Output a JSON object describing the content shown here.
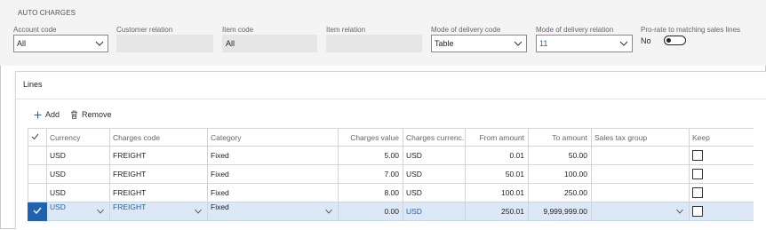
{
  "section_title": "AUTO CHARGES",
  "fields": {
    "account_code": {
      "label": "Account code",
      "value": "All"
    },
    "customer_relation": {
      "label": "Customer relation",
      "value": ""
    },
    "item_code": {
      "label": "Item code",
      "value": "All"
    },
    "item_relation": {
      "label": "Item relation",
      "value": ""
    },
    "mode_of_delivery_code": {
      "label": "Mode of delivery code",
      "value": "Table"
    },
    "mode_of_delivery_relation": {
      "label": "Mode of delivery relation",
      "value": "11"
    },
    "prorate": {
      "label": "Pro-rate to matching sales lines",
      "value": "No"
    }
  },
  "lines": {
    "title": "Lines",
    "add_label": "Add",
    "remove_label": "Remove",
    "columns": [
      "Currency",
      "Charges code",
      "Category",
      "Charges value",
      "Charges currenc...",
      "From amount",
      "To amount",
      "Sales tax group",
      "Keep"
    ],
    "rows": [
      {
        "currency": "USD",
        "charges_code": "FREIGHT",
        "category": "Fixed",
        "charges_value": "5.00",
        "charges_currency": "USD",
        "from_amount": "0.01",
        "to_amount": "50.00",
        "sales_tax_group": "",
        "keep": false
      },
      {
        "currency": "USD",
        "charges_code": "FREIGHT",
        "category": "Fixed",
        "charges_value": "7.00",
        "charges_currency": "USD",
        "from_amount": "50.01",
        "to_amount": "100.00",
        "sales_tax_group": "",
        "keep": false
      },
      {
        "currency": "USD",
        "charges_code": "FREIGHT",
        "category": "Fixed",
        "charges_value": "8.00",
        "charges_currency": "USD",
        "from_amount": "100.01",
        "to_amount": "250.00",
        "sales_tax_group": "",
        "keep": false
      },
      {
        "currency": "USD",
        "charges_code": "FREIGHT",
        "category": "Fixed",
        "charges_value": "0.00",
        "charges_currency": "USD",
        "from_amount": "250.01",
        "to_amount": "9,999,999.00",
        "sales_tax_group": "",
        "keep": false
      }
    ],
    "selected_row": 3
  },
  "colors": {
    "accent": "#1e62b0",
    "selected_row_bg": "#dde8f6",
    "header_bg": "#f4f4f4"
  }
}
